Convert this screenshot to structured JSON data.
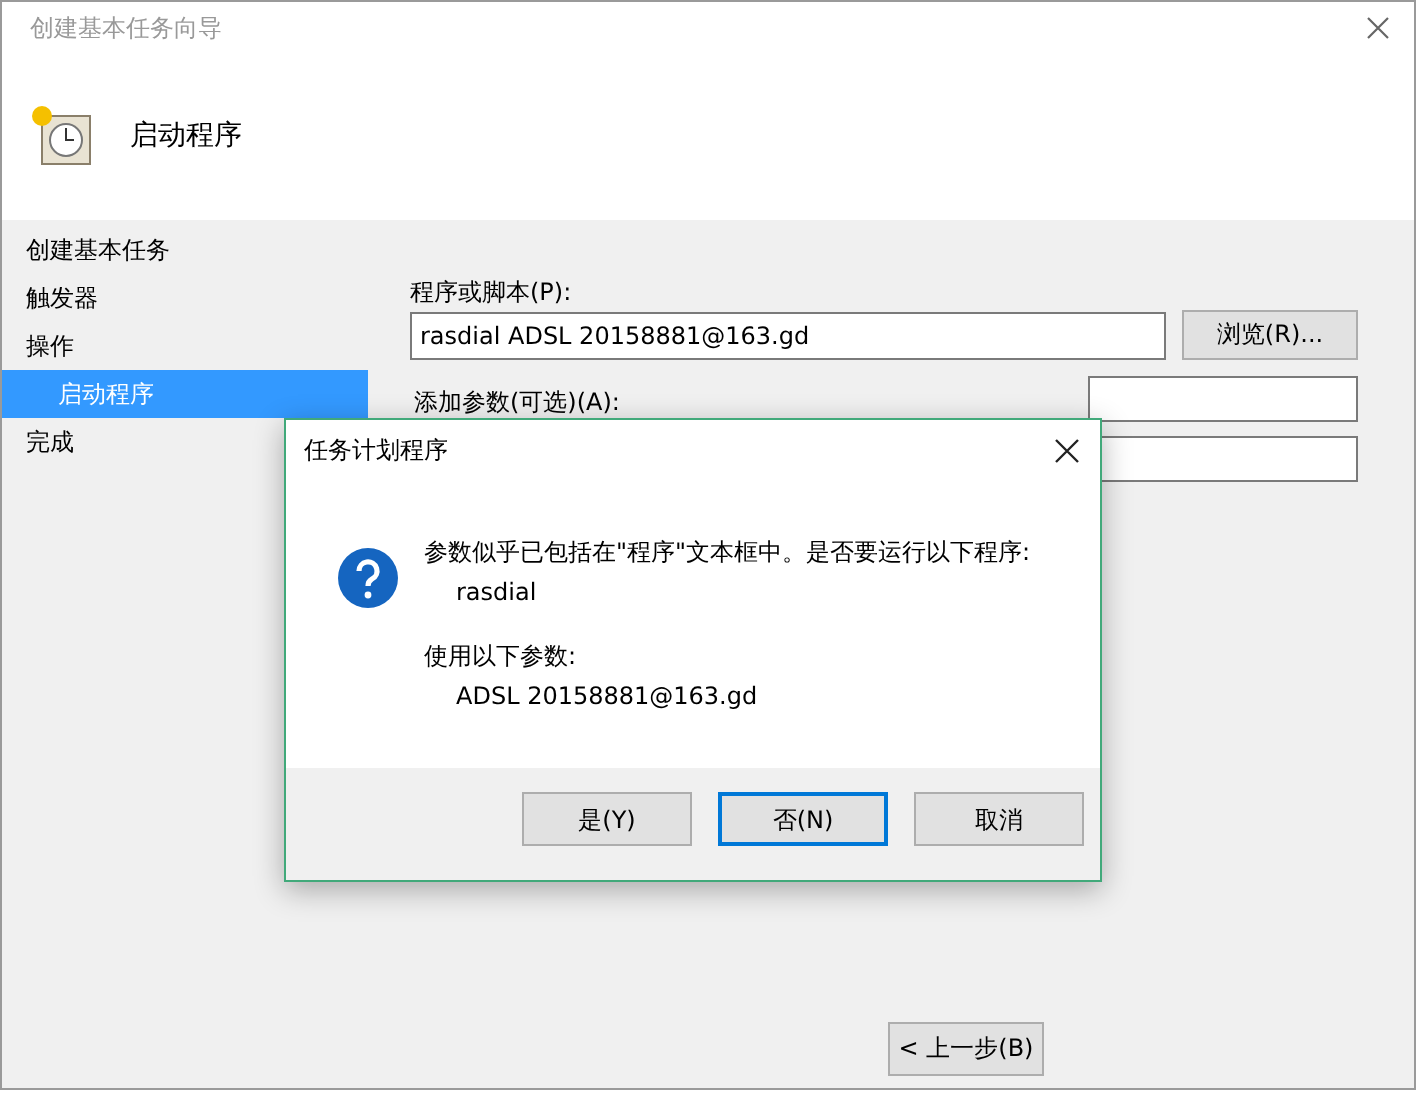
{
  "window": {
    "title": "创建基本任务向导"
  },
  "header": {
    "title": "启动程序"
  },
  "steps": [
    {
      "label": "创建基本任务",
      "selected": false
    },
    {
      "label": "触发器",
      "selected": false
    },
    {
      "label": "操作",
      "selected": false,
      "children": [
        {
          "label": "启动程序",
          "selected": true
        }
      ]
    },
    {
      "label": "完成",
      "selected": false
    }
  ],
  "form": {
    "program_label": "程序或脚本(P):",
    "program_value": "rasdial ADSL 20158881@163.gd",
    "browse_button": "浏览(R)...",
    "arguments_label": "添加参数(可选)(A):"
  },
  "back_button": "< 上一步(B)",
  "dialog": {
    "title": "任务计划程序",
    "message": "参数似乎已包括在\"程序\"文本框中。是否要运行以下程序:",
    "program": "rasdial",
    "params_label": "使用以下参数:",
    "params": "ADSL 20158881@163.gd",
    "buttons": [
      {
        "label": "是(Y)",
        "focused": false
      },
      {
        "label": "否(N)",
        "focused": true
      },
      {
        "label": "取消",
        "focused": false
      }
    ]
  }
}
